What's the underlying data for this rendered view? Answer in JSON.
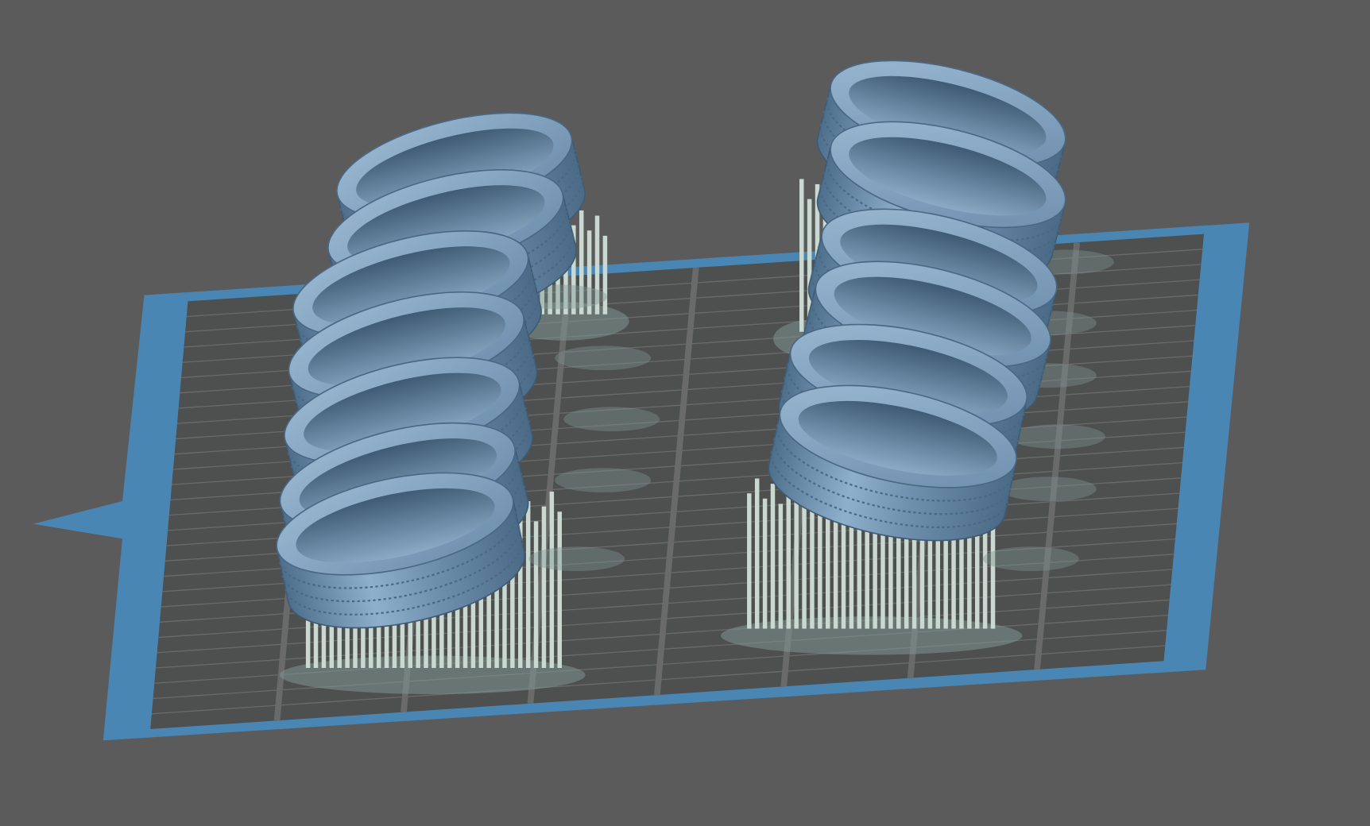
{
  "viewport": {
    "background_color": "#5b5b5b",
    "plate_border_color": "#4a86b4",
    "plate_surface_color": "#4e4f4f",
    "grid_line_color": "#6a6a6a",
    "model_color": "#7f9fbd",
    "support_color": "#c9d8d0",
    "support_shadow_color": "#7f9590"
  }
}
